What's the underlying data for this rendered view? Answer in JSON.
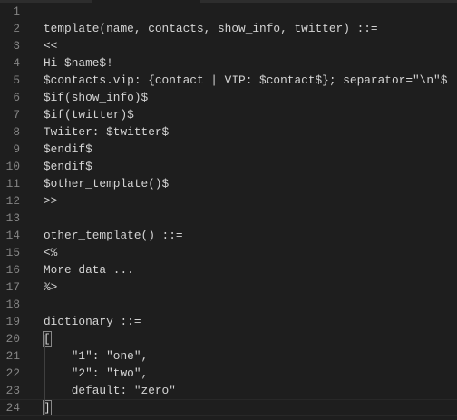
{
  "editor": {
    "lines": [
      "",
      "template(name, contacts, show_info, twitter) ::=",
      "<<",
      "Hi $name$!",
      "$contacts.vip: {contact | VIP: $contact$}; separator=\"\\n\"$",
      "$if(show_info)$",
      "$if(twitter)$",
      "Twiiter: $twitter$",
      "$endif$",
      "$endif$",
      "$other_template()$",
      ">>",
      "",
      "other_template() ::=",
      "<%",
      "More data ...",
      "%>",
      "",
      "dictionary ::=",
      "[",
      "    \"1\": \"one\",",
      "    \"2\": \"two\",",
      "    default: \"zero\"",
      "]"
    ],
    "current_line": 24,
    "colors": {
      "background": "#1e1e1e",
      "text": "#d4d4d4",
      "line_number": "#858585"
    }
  }
}
